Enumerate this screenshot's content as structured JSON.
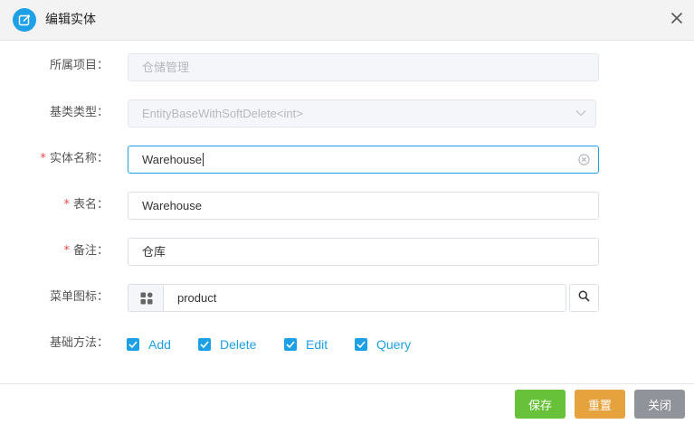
{
  "dialog": {
    "title": "编辑实体"
  },
  "form": {
    "project": {
      "label": "所属项目：",
      "value": "仓储管理"
    },
    "base_type": {
      "label": "基类类型：",
      "value": "EntityBaseWithSoftDelete<int>"
    },
    "entity_name": {
      "label": "实体名称：",
      "value": "Warehouse",
      "required": true
    },
    "table_name": {
      "label": "表名：",
      "value": "Warehouse",
      "required": true
    },
    "remark": {
      "label": "备注：",
      "value": "仓库",
      "required": true
    },
    "menu_icon": {
      "label": "菜单图标：",
      "value": "product"
    },
    "base_methods": {
      "label": "基础方法：",
      "options": [
        {
          "label": "Add",
          "checked": true
        },
        {
          "label": "Delete",
          "checked": true
        },
        {
          "label": "Edit",
          "checked": true
        },
        {
          "label": "Query",
          "checked": true
        }
      ]
    }
  },
  "footer": {
    "save_label": "保存",
    "reset_label": "重置",
    "close_label": "关闭"
  },
  "colors": {
    "accent": "#1ea0e6",
    "save": "#67c23a",
    "reset": "#e6a23c",
    "close": "#909399",
    "required": "#f04848"
  },
  "icons": {
    "header": "edit-icon",
    "close": "close-icon",
    "clear": "clear-circle-icon",
    "chevron": "chevron-down-icon",
    "menu_icon_preview": "grid-icon",
    "search": "search-icon",
    "check": "check-icon"
  }
}
